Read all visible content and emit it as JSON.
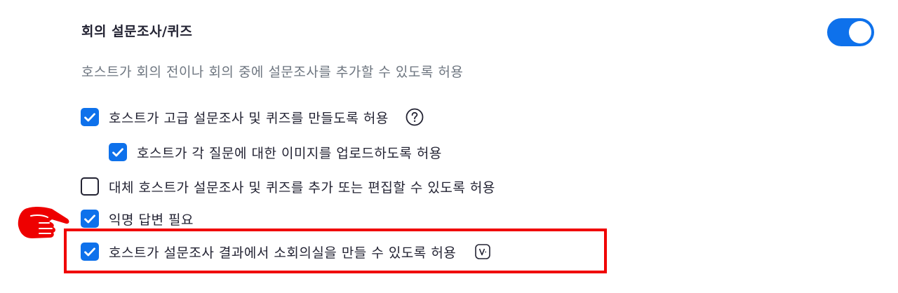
{
  "setting": {
    "title": "회의 설문조사/퀴즈",
    "description": "호스트가 회의 전이나 회의 중에 설문조사를 추가할 수 있도록 허용",
    "toggle_on": true
  },
  "options": [
    {
      "label": "호스트가 고급 설문조사 및 퀴즈를 만들도록 허용",
      "checked": true,
      "icon": "question-circle-icon"
    },
    {
      "label": "호스트가 각 질문에 대한 이미지를 업로드하도록 허용",
      "checked": true
    },
    {
      "label": "대체 호스트가 설문조사 및 퀴즈를 추가 또는 편집할 수 있도록 허용",
      "checked": false
    },
    {
      "label": "익명 답변 필요",
      "checked": true
    },
    {
      "label": "호스트가 설문조사 결과에서 소회의실을 만들 수 있도록 허용",
      "checked": true,
      "icon": "version-badge-icon"
    }
  ],
  "annotations": {
    "highlight_color": "#f00000",
    "pointer_icon": "pointing-hand-icon"
  },
  "colors": {
    "accent": "#0e71eb",
    "text": "#232333",
    "secondary_text": "#6e7680"
  }
}
